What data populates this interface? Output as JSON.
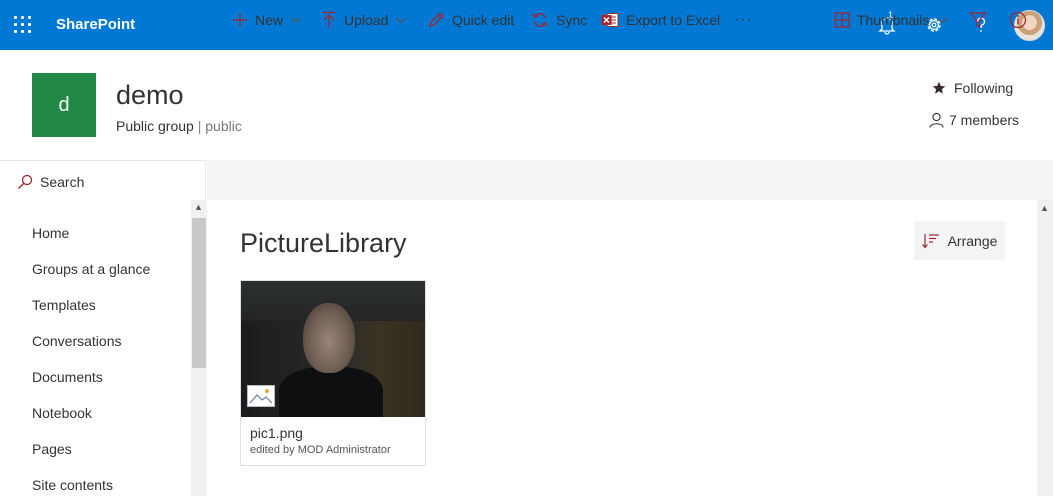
{
  "suitebar": {
    "brand": "SharePoint",
    "notification_count": "1",
    "bg_color": "#0078d4"
  },
  "site": {
    "logo_letter": "d",
    "logo_color": "#218845",
    "title": "demo",
    "group_type": "Public group",
    "separator": "|",
    "privacy": "public",
    "following_label": "Following",
    "members_label": "7 members"
  },
  "search": {
    "label": "Search"
  },
  "commandbar": {
    "new_label": "New",
    "upload_label": "Upload",
    "quick_edit_label": "Quick edit",
    "sync_label": "Sync",
    "export_label": "Export to Excel",
    "more_label": "···",
    "view_label": "Thumbnails"
  },
  "nav": {
    "items": [
      {
        "label": "Home"
      },
      {
        "label": "Groups at a glance"
      },
      {
        "label": "Templates"
      },
      {
        "label": "Conversations"
      },
      {
        "label": "Documents"
      },
      {
        "label": "Notebook"
      },
      {
        "label": "Pages"
      },
      {
        "label": "Site contents"
      }
    ]
  },
  "library": {
    "title": "PictureLibrary",
    "arrange_label": "Arrange",
    "items": [
      {
        "name": "pic1.png",
        "edited": "edited by MOD Administrator"
      }
    ]
  },
  "icons": {
    "waffle": "waffle-icon",
    "bell": "bell-icon",
    "gear": "gear-icon",
    "help": "help-icon",
    "star": "star-icon",
    "person": "person-icon",
    "search": "search-icon",
    "add": "add-icon",
    "upload": "upload-icon",
    "pencil": "pencil-icon",
    "sync": "sync-icon",
    "excel": "excel-icon",
    "grid": "grid-view-icon",
    "filter": "filter-icon",
    "info": "info-icon",
    "sort": "sort-icon"
  }
}
